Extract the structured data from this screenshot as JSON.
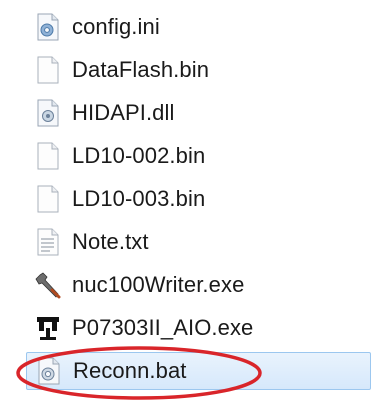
{
  "files": [
    {
      "name": "config.ini",
      "icon": "settings-file-icon"
    },
    {
      "name": "DataFlash.bin",
      "icon": "blank-file-icon"
    },
    {
      "name": "HIDAPI.dll",
      "icon": "dll-file-icon"
    },
    {
      "name": "LD10-002.bin",
      "icon": "blank-file-icon"
    },
    {
      "name": "LD10-003.bin",
      "icon": "blank-file-icon"
    },
    {
      "name": "Note.txt",
      "icon": "text-file-icon"
    },
    {
      "name": "nuc100Writer.exe",
      "icon": "wrench-app-icon"
    },
    {
      "name": "P07303II_AIO.exe",
      "icon": "app-exe-icon"
    },
    {
      "name": "Reconn.bat",
      "icon": "batch-file-icon",
      "selected": true
    }
  ],
  "highlight": {
    "shape": "ellipse",
    "color": "#d9252a",
    "target": "Reconn.bat"
  }
}
